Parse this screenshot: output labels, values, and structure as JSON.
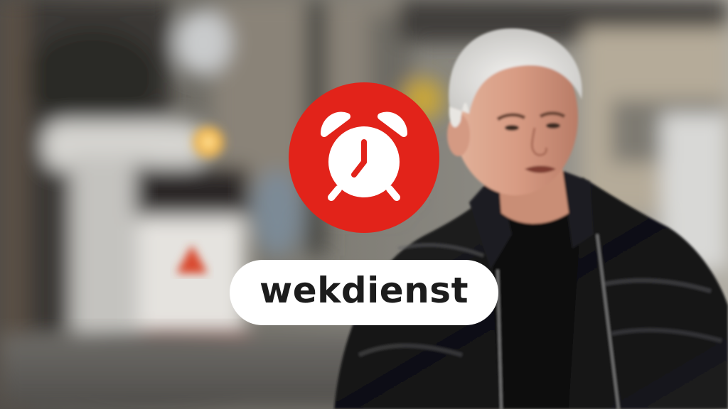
{
  "program": {
    "title": "wekdienst"
  },
  "icons": {
    "logo": "alarm-clock-icon"
  },
  "colors": {
    "brand_red": "#e2231a",
    "pill_background": "#ffffff",
    "title_text": "#1c1c1c"
  }
}
